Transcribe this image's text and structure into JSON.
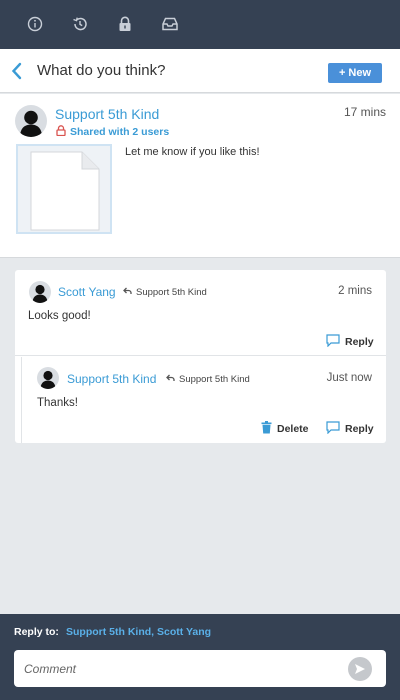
{
  "toolbar": {
    "icons": [
      "info-icon",
      "history-icon",
      "lock-icon",
      "inbox-icon"
    ]
  },
  "header": {
    "title": "What do you think?",
    "new_label": "+ New"
  },
  "post": {
    "author": "Support 5th Kind",
    "time": "17 mins",
    "shared": "Shared with 2 users",
    "message": "Let me know if you like this!"
  },
  "comments": [
    {
      "author": "Scott Yang",
      "reply_to": "Support 5th Kind",
      "time": "2 mins",
      "message": "Looks good!",
      "reply_label": "Reply"
    },
    {
      "author": "Support 5th Kind",
      "reply_to": "Support 5th Kind",
      "time": "Just now",
      "message": "Thanks!",
      "delete_label": "Delete",
      "reply_label": "Reply"
    }
  ],
  "footer": {
    "reply_to_label": "Reply to:",
    "reply_to_names": "Support 5th Kind,   Scott Yang",
    "comment_placeholder": "Comment"
  },
  "colors": {
    "toolbar_bg": "#354153",
    "accent": "#3a9bd5",
    "button": "#4a90d9",
    "lock": "#d9534f"
  }
}
